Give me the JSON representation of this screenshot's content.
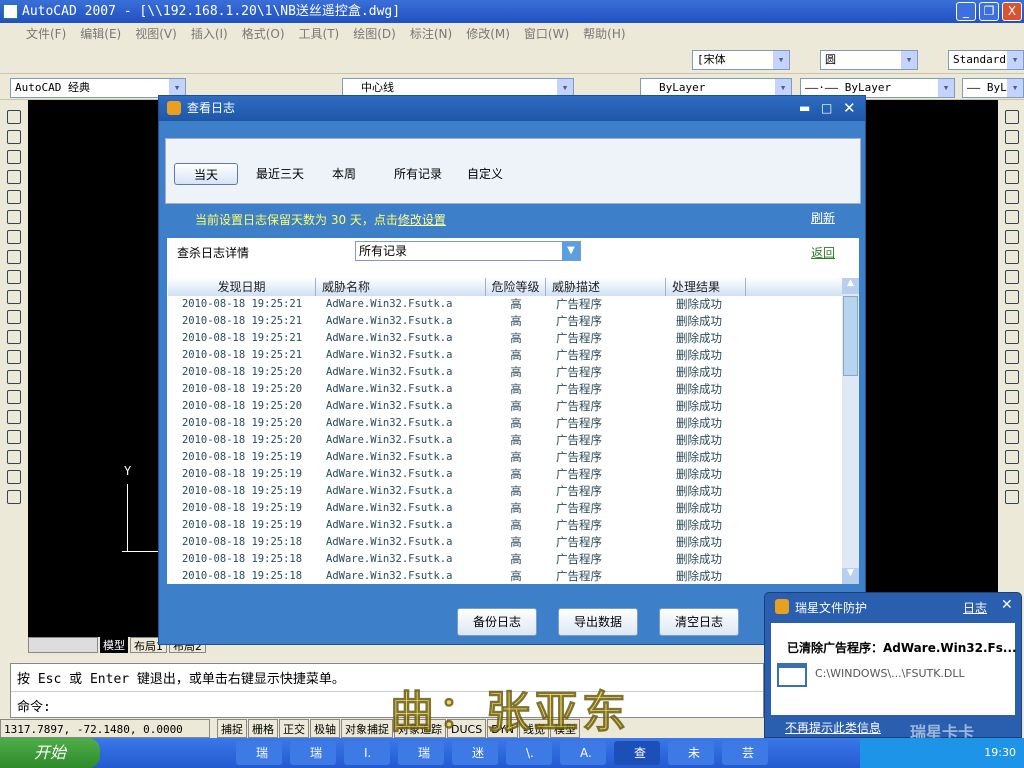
{
  "window": {
    "title": "AutoCAD 2007 - [\\\\192.168.1.20\\1\\NB送丝遥控盒.dwg]",
    "min": "_",
    "restore": "❐",
    "close": "X"
  },
  "menu": [
    "文件(F)",
    "编辑(E)",
    "视图(V)",
    "插入(I)",
    "格式(O)",
    "工具(T)",
    "绘图(D)",
    "标注(N)",
    "修改(M)",
    "窗口(W)",
    "帮助(H)"
  ],
  "toolbar": {
    "font_combo": "[宋体",
    "dimstyle_combo": "圆",
    "style_combo": "Standard",
    "workspace_combo": "AutoCAD 经典",
    "layer_combo": "中心线",
    "color_combo": "ByLayer",
    "linetype_combo": "——·—— ByLayer",
    "lineweight_combo": "—— ByL"
  },
  "dialog": {
    "title": "查看日志",
    "tabs": [
      "当天",
      "最近三天",
      "本周",
      "所有记录",
      "自定义"
    ],
    "info_prefix": "当前设置日志保留天数为 30 天，点击",
    "info_link": "修改设置",
    "refresh": "刷新",
    "filter_label": "查杀日志详情",
    "filter_value": "所有记录",
    "back": "返回",
    "columns": [
      "发现日期",
      "威胁名称",
      "危险等级",
      "威胁描述",
      "处理结果"
    ],
    "rows": [
      [
        "2010-08-18 19:25:21",
        "AdWare.Win32.Fsutk.a",
        "高",
        "广告程序",
        "删除成功"
      ],
      [
        "2010-08-18 19:25:21",
        "AdWare.Win32.Fsutk.a",
        "高",
        "广告程序",
        "删除成功"
      ],
      [
        "2010-08-18 19:25:21",
        "AdWare.Win32.Fsutk.a",
        "高",
        "广告程序",
        "删除成功"
      ],
      [
        "2010-08-18 19:25:21",
        "AdWare.Win32.Fsutk.a",
        "高",
        "广告程序",
        "删除成功"
      ],
      [
        "2010-08-18 19:25:20",
        "AdWare.Win32.Fsutk.a",
        "高",
        "广告程序",
        "删除成功"
      ],
      [
        "2010-08-18 19:25:20",
        "AdWare.Win32.Fsutk.a",
        "高",
        "广告程序",
        "删除成功"
      ],
      [
        "2010-08-18 19:25:20",
        "AdWare.Win32.Fsutk.a",
        "高",
        "广告程序",
        "删除成功"
      ],
      [
        "2010-08-18 19:25:20",
        "AdWare.Win32.Fsutk.a",
        "高",
        "广告程序",
        "删除成功"
      ],
      [
        "2010-08-18 19:25:20",
        "AdWare.Win32.Fsutk.a",
        "高",
        "广告程序",
        "删除成功"
      ],
      [
        "2010-08-18 19:25:19",
        "AdWare.Win32.Fsutk.a",
        "高",
        "广告程序",
        "删除成功"
      ],
      [
        "2010-08-18 19:25:19",
        "AdWare.Win32.Fsutk.a",
        "高",
        "广告程序",
        "删除成功"
      ],
      [
        "2010-08-18 19:25:19",
        "AdWare.Win32.Fsutk.a",
        "高",
        "广告程序",
        "删除成功"
      ],
      [
        "2010-08-18 19:25:19",
        "AdWare.Win32.Fsutk.a",
        "高",
        "广告程序",
        "删除成功"
      ],
      [
        "2010-08-18 19:25:19",
        "AdWare.Win32.Fsutk.a",
        "高",
        "广告程序",
        "删除成功"
      ],
      [
        "2010-08-18 19:25:18",
        "AdWare.Win32.Fsutk.a",
        "高",
        "广告程序",
        "删除成功"
      ],
      [
        "2010-08-18 19:25:18",
        "AdWare.Win32.Fsutk.a",
        "高",
        "广告程序",
        "删除成功"
      ],
      [
        "2010-08-18 19:25:18",
        "AdWare.Win32.Fsutk.a",
        "高",
        "广告程序",
        "删除成功"
      ]
    ],
    "buttons": [
      "备份日志",
      "导出数据",
      "清空日志"
    ]
  },
  "model_tabs": [
    "模型",
    "布局1",
    "布局2"
  ],
  "ucs": {
    "y": "Y"
  },
  "command": {
    "line1": "按 Esc 或 Enter 键退出，或单击右键显示快捷菜单。",
    "prompt": "命令:"
  },
  "status": {
    "coords": "1317.7897, -72.1480, 0.0000",
    "toggles": [
      "捕捉",
      "栅格",
      "正交",
      "极轴",
      "对象捕捉",
      "对象追踪",
      "DUCS",
      "DYN",
      "线宽",
      "模型"
    ]
  },
  "watermark": "曲：张亚东",
  "popup": {
    "title": "瑞星文件防护",
    "log_link": "日志",
    "close": "✕",
    "message": "已清除广告程序：AdWare.Win32.Fs...",
    "file": "C:\\WINDOWS\\...\\FSUTK.DLL",
    "dismiss": "不再提示此类信息",
    "brand": "瑞星卡卡"
  },
  "taskbar": {
    "start": "开始",
    "tasks": [
      "瑞",
      "瑞",
      "I.",
      "瑞",
      "迷",
      "\\.",
      "A.",
      "查",
      "未",
      "芸"
    ],
    "clock": "19:30"
  }
}
